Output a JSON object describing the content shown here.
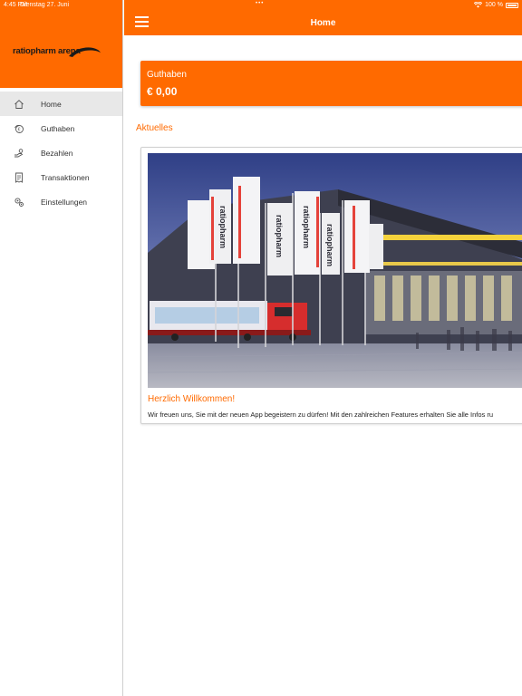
{
  "status_bar": {
    "time": "4:45 PM",
    "date": "Dienstag 27. Juni",
    "battery": "100 %",
    "icons": [
      "wifi-icon",
      "battery-icon"
    ]
  },
  "logo": {
    "text": "ratiopharm arena"
  },
  "nav": {
    "items": [
      {
        "label": "Home",
        "icon": "home-icon",
        "active": true
      },
      {
        "label": "Guthaben",
        "icon": "wallet-icon",
        "active": false
      },
      {
        "label": "Bezahlen",
        "icon": "pay-icon",
        "active": false
      },
      {
        "label": "Transaktionen",
        "icon": "receipt-icon",
        "active": false
      },
      {
        "label": "Einstellungen",
        "icon": "gear-icon",
        "active": false
      }
    ]
  },
  "topbar": {
    "title": "Home",
    "menu_icon": "hamburger-icon"
  },
  "balance": {
    "label": "Guthaben",
    "value": "€ 0,00"
  },
  "section": {
    "title": "Aktuelles"
  },
  "news": {
    "title": "Herzlich Willkommen!",
    "text": "Wir freuen uns, Sie mit der neuen App begeistern zu dürfen! Mit den zahlreichen Features erhalten Sie alle Infos ru",
    "image_alt": "ratiopharm arena exterior at dusk with flags",
    "flag_text": "ratiopharm"
  },
  "colors": {
    "accent": "#ff6a00",
    "active_bg": "#e8e8e8",
    "text": "#333333"
  }
}
